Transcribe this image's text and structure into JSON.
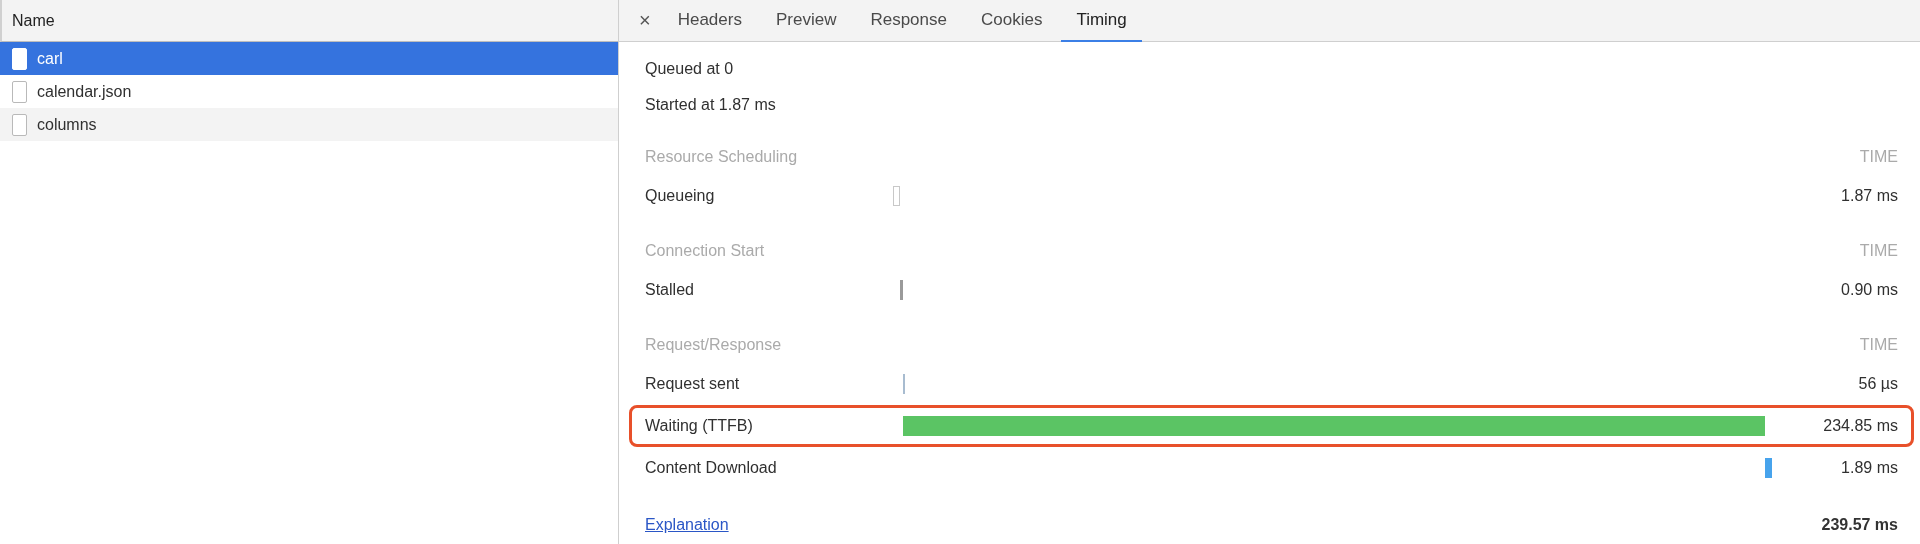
{
  "request_list": {
    "column": "Name",
    "rows": [
      {
        "name": "carl",
        "selected": true
      },
      {
        "name": "calendar.json",
        "selected": false
      },
      {
        "name": "columns",
        "selected": false
      }
    ]
  },
  "tabs": {
    "close": "×",
    "items": [
      {
        "label": "Headers",
        "selected": false
      },
      {
        "label": "Preview",
        "selected": false
      },
      {
        "label": "Response",
        "selected": false
      },
      {
        "label": "Cookies",
        "selected": false
      },
      {
        "label": "Timing",
        "selected": true
      }
    ]
  },
  "timing": {
    "queued": "Queued at 0",
    "started": "Started at 1.87 ms",
    "sections": [
      {
        "title": "Resource Scheduling",
        "time_header": "TIME",
        "rows": [
          {
            "label": "Queueing",
            "kind": "outline",
            "color": "#c8c8c8",
            "value": "1.87 ms",
            "highlighted": false
          }
        ]
      },
      {
        "title": "Connection Start",
        "time_header": "TIME",
        "rows": [
          {
            "label": "Stalled",
            "kind": "solid",
            "color": "#9a9a9a",
            "value": "0.90 ms",
            "highlighted": false
          }
        ]
      },
      {
        "title": "Request/Response",
        "time_header": "TIME",
        "rows": [
          {
            "label": "Request sent",
            "kind": "solid",
            "color": "#a8bcd0",
            "value": "56 µs",
            "highlighted": false
          },
          {
            "label": "Waiting (TTFB)",
            "kind": "solid",
            "color": "#5bc464",
            "value": "234.85 ms",
            "highlighted": true
          },
          {
            "label": "Content Download",
            "kind": "solid",
            "color": "#47a3ec",
            "value": "1.89 ms",
            "highlighted": false
          }
        ]
      }
    ],
    "explanation": "Explanation",
    "total": "239.57 ms"
  }
}
